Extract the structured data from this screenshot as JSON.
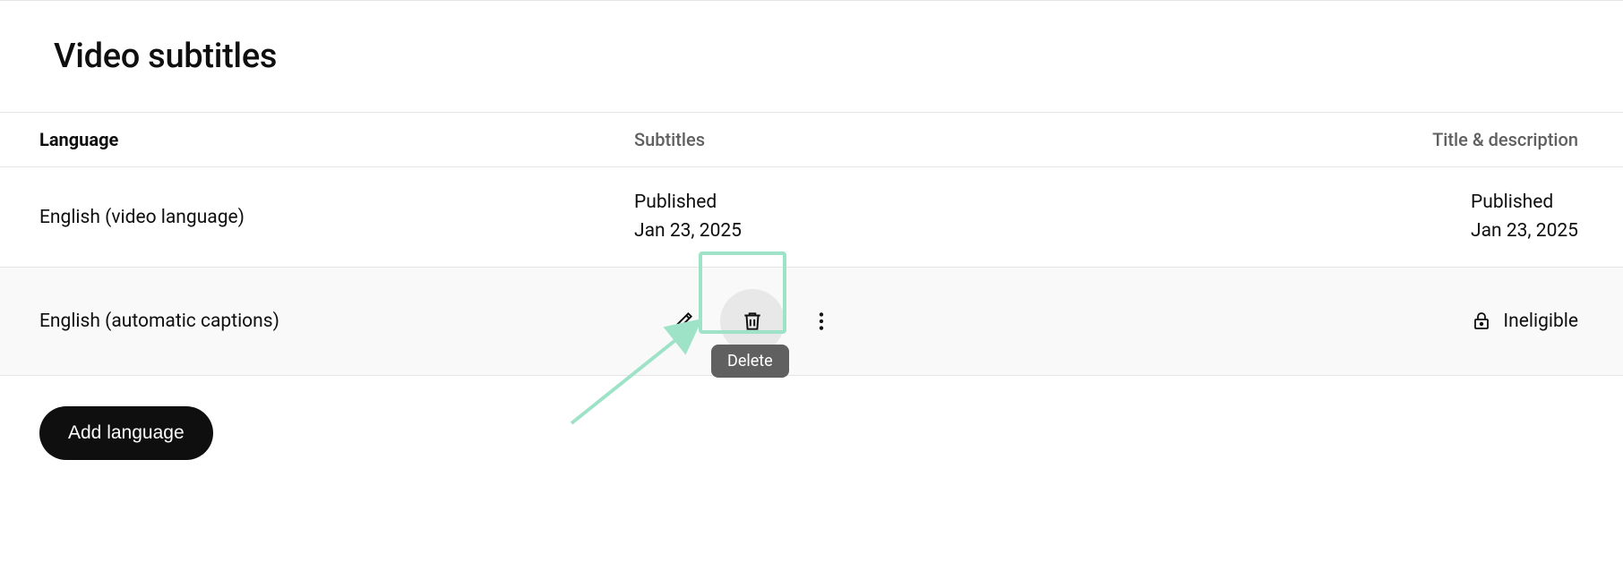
{
  "page": {
    "title": "Video subtitles"
  },
  "columns": {
    "language": "Language",
    "subtitles": "Subtitles",
    "title_desc": "Title & description"
  },
  "rows": [
    {
      "language": "English (video language)",
      "subtitles": {
        "status": "Published",
        "date": "Jan 23, 2025"
      },
      "title_desc": {
        "status": "Published",
        "date": "Jan 23, 2025"
      }
    },
    {
      "language": "English (automatic captions)",
      "title_desc": {
        "status": "Ineligible"
      }
    }
  ],
  "tooltip": {
    "delete": "Delete"
  },
  "buttons": {
    "add_language": "Add language"
  }
}
